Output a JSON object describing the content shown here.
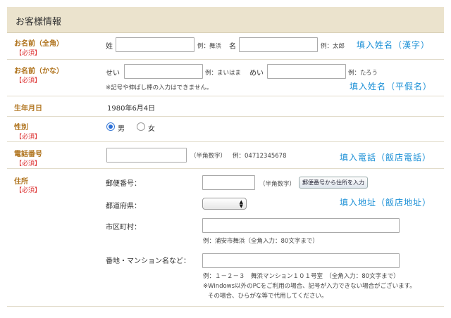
{
  "section_title": "お客様情報",
  "required_label": "【必須】",
  "name_kanji": {
    "label": "お名前（全角）",
    "sei_label": "姓",
    "sei_example": "例：舞浜",
    "mei_label": "名",
    "mei_example": "例：太郎",
    "annotation": "填入姓名（漢字）"
  },
  "name_kana": {
    "label": "お名前（かな）",
    "sei_label": "せい",
    "sei_example": "例：まいはま",
    "mei_label": "めい",
    "mei_example": "例：たろう",
    "note": "※記号や伸ばし棒の入力はできません。",
    "annotation": "填入姓名（平假名）"
  },
  "birthday": {
    "label": "生年月日",
    "value": "1980年6月4日"
  },
  "gender": {
    "label": "性別",
    "options": [
      "男",
      "女"
    ],
    "selected": "男"
  },
  "phone": {
    "label": "電話番号",
    "hint": "（半角数字）",
    "example": "例：04712345678",
    "annotation": "填入電話（飯店電話）"
  },
  "address": {
    "label": "住所",
    "postal_label": "郵便番号：",
    "postal_hint": "（半角数字）",
    "postal_button": "郵便番号から住所を入力",
    "prefecture_label": "都道府県：",
    "city_label": "市区町村：",
    "city_example": "例：浦安市舞浜（全角入力：80文字まで）",
    "street_label": "番地・マンション名など：",
    "street_example": "例：１－２－３　舞浜マンション１０１号室　（全角入力：80文字まで）",
    "street_note_1": "※Windows以外のPCをご利用の場合、記号が入力できない場合がございます。",
    "street_note_2": "その場合、ひらがな等で代用してください。",
    "annotation": "填入地址（飯店地址）"
  }
}
